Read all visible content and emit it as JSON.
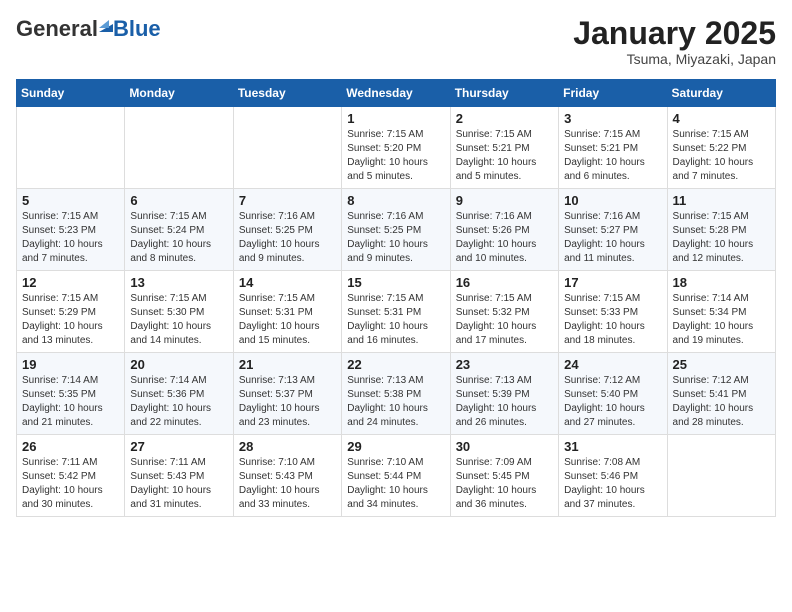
{
  "logo": {
    "general": "General",
    "blue": "Blue"
  },
  "title": "January 2025",
  "location": "Tsuma, Miyazaki, Japan",
  "weekdays": [
    "Sunday",
    "Monday",
    "Tuesday",
    "Wednesday",
    "Thursday",
    "Friday",
    "Saturday"
  ],
  "weeks": [
    [
      {
        "day": "",
        "info": ""
      },
      {
        "day": "",
        "info": ""
      },
      {
        "day": "",
        "info": ""
      },
      {
        "day": "1",
        "info": "Sunrise: 7:15 AM\nSunset: 5:20 PM\nDaylight: 10 hours\nand 5 minutes."
      },
      {
        "day": "2",
        "info": "Sunrise: 7:15 AM\nSunset: 5:21 PM\nDaylight: 10 hours\nand 5 minutes."
      },
      {
        "day": "3",
        "info": "Sunrise: 7:15 AM\nSunset: 5:21 PM\nDaylight: 10 hours\nand 6 minutes."
      },
      {
        "day": "4",
        "info": "Sunrise: 7:15 AM\nSunset: 5:22 PM\nDaylight: 10 hours\nand 7 minutes."
      }
    ],
    [
      {
        "day": "5",
        "info": "Sunrise: 7:15 AM\nSunset: 5:23 PM\nDaylight: 10 hours\nand 7 minutes."
      },
      {
        "day": "6",
        "info": "Sunrise: 7:15 AM\nSunset: 5:24 PM\nDaylight: 10 hours\nand 8 minutes."
      },
      {
        "day": "7",
        "info": "Sunrise: 7:16 AM\nSunset: 5:25 PM\nDaylight: 10 hours\nand 9 minutes."
      },
      {
        "day": "8",
        "info": "Sunrise: 7:16 AM\nSunset: 5:25 PM\nDaylight: 10 hours\nand 9 minutes."
      },
      {
        "day": "9",
        "info": "Sunrise: 7:16 AM\nSunset: 5:26 PM\nDaylight: 10 hours\nand 10 minutes."
      },
      {
        "day": "10",
        "info": "Sunrise: 7:16 AM\nSunset: 5:27 PM\nDaylight: 10 hours\nand 11 minutes."
      },
      {
        "day": "11",
        "info": "Sunrise: 7:15 AM\nSunset: 5:28 PM\nDaylight: 10 hours\nand 12 minutes."
      }
    ],
    [
      {
        "day": "12",
        "info": "Sunrise: 7:15 AM\nSunset: 5:29 PM\nDaylight: 10 hours\nand 13 minutes."
      },
      {
        "day": "13",
        "info": "Sunrise: 7:15 AM\nSunset: 5:30 PM\nDaylight: 10 hours\nand 14 minutes."
      },
      {
        "day": "14",
        "info": "Sunrise: 7:15 AM\nSunset: 5:31 PM\nDaylight: 10 hours\nand 15 minutes."
      },
      {
        "day": "15",
        "info": "Sunrise: 7:15 AM\nSunset: 5:31 PM\nDaylight: 10 hours\nand 16 minutes."
      },
      {
        "day": "16",
        "info": "Sunrise: 7:15 AM\nSunset: 5:32 PM\nDaylight: 10 hours\nand 17 minutes."
      },
      {
        "day": "17",
        "info": "Sunrise: 7:15 AM\nSunset: 5:33 PM\nDaylight: 10 hours\nand 18 minutes."
      },
      {
        "day": "18",
        "info": "Sunrise: 7:14 AM\nSunset: 5:34 PM\nDaylight: 10 hours\nand 19 minutes."
      }
    ],
    [
      {
        "day": "19",
        "info": "Sunrise: 7:14 AM\nSunset: 5:35 PM\nDaylight: 10 hours\nand 21 minutes."
      },
      {
        "day": "20",
        "info": "Sunrise: 7:14 AM\nSunset: 5:36 PM\nDaylight: 10 hours\nand 22 minutes."
      },
      {
        "day": "21",
        "info": "Sunrise: 7:13 AM\nSunset: 5:37 PM\nDaylight: 10 hours\nand 23 minutes."
      },
      {
        "day": "22",
        "info": "Sunrise: 7:13 AM\nSunset: 5:38 PM\nDaylight: 10 hours\nand 24 minutes."
      },
      {
        "day": "23",
        "info": "Sunrise: 7:13 AM\nSunset: 5:39 PM\nDaylight: 10 hours\nand 26 minutes."
      },
      {
        "day": "24",
        "info": "Sunrise: 7:12 AM\nSunset: 5:40 PM\nDaylight: 10 hours\nand 27 minutes."
      },
      {
        "day": "25",
        "info": "Sunrise: 7:12 AM\nSunset: 5:41 PM\nDaylight: 10 hours\nand 28 minutes."
      }
    ],
    [
      {
        "day": "26",
        "info": "Sunrise: 7:11 AM\nSunset: 5:42 PM\nDaylight: 10 hours\nand 30 minutes."
      },
      {
        "day": "27",
        "info": "Sunrise: 7:11 AM\nSunset: 5:43 PM\nDaylight: 10 hours\nand 31 minutes."
      },
      {
        "day": "28",
        "info": "Sunrise: 7:10 AM\nSunset: 5:43 PM\nDaylight: 10 hours\nand 33 minutes."
      },
      {
        "day": "29",
        "info": "Sunrise: 7:10 AM\nSunset: 5:44 PM\nDaylight: 10 hours\nand 34 minutes."
      },
      {
        "day": "30",
        "info": "Sunrise: 7:09 AM\nSunset: 5:45 PM\nDaylight: 10 hours\nand 36 minutes."
      },
      {
        "day": "31",
        "info": "Sunrise: 7:08 AM\nSunset: 5:46 PM\nDaylight: 10 hours\nand 37 minutes."
      },
      {
        "day": "",
        "info": ""
      }
    ]
  ]
}
